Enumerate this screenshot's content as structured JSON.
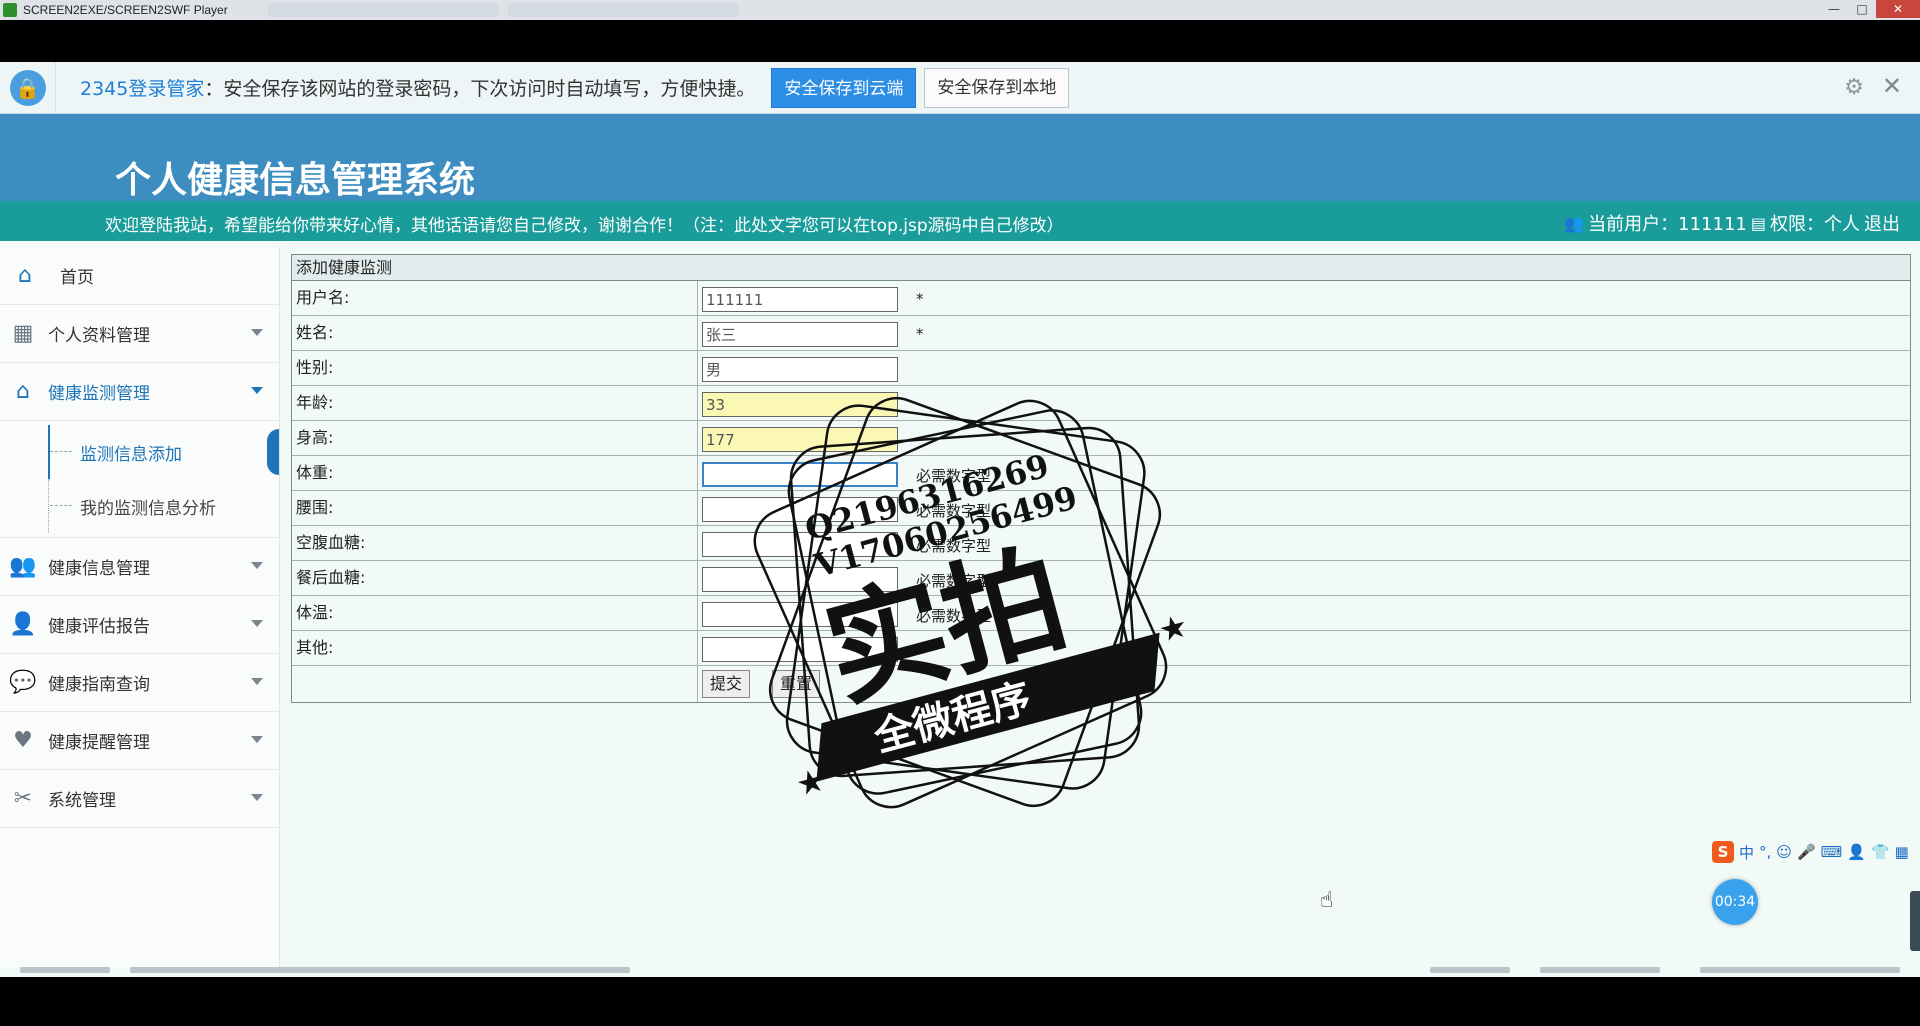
{
  "player": {
    "title": "SCREEN2EXE/SCREEN2SWF Player",
    "controls": [
      "—",
      "□",
      "✕"
    ]
  },
  "password_bar": {
    "brand": "2345登录管家",
    "message": "：安全保存该网站的登录密码，下次访问时自动填写，方便快捷。",
    "save_cloud": "安全保存到云端",
    "save_local": "安全保存到本地"
  },
  "app": {
    "title": "个人健康信息管理系统",
    "welcome": "欢迎登陆我站，希望能给你带来好心情，其他话语请您自己修改，谢谢合作！（注：此处文字您可以在top.jsp源码中自己修改）",
    "current_user_label": "当前用户：111111",
    "permission_label": "权限：个人",
    "logout": "退出"
  },
  "sidebar": {
    "home": "首页",
    "items": [
      {
        "label": "个人资料管理",
        "icon": "grid-icon"
      },
      {
        "label": "健康监测管理",
        "icon": "home-icon"
      },
      {
        "label": "健康信息管理",
        "icon": "users-icon"
      },
      {
        "label": "健康评估报告",
        "icon": "user-icon"
      },
      {
        "label": "健康指南查询",
        "icon": "chat-icon"
      },
      {
        "label": "健康提醒管理",
        "icon": "heart-icon"
      },
      {
        "label": "系统管理",
        "icon": "tools-icon"
      }
    ],
    "sub_items": [
      "监测信息添加",
      "我的监测信息分析"
    ]
  },
  "form": {
    "heading": "添加健康监测",
    "fields": [
      {
        "label": "用户名:",
        "value": "111111",
        "hint": "*"
      },
      {
        "label": "姓名:",
        "value": "张三",
        "hint": "*"
      },
      {
        "label": "性别:",
        "value": "男",
        "hint": ""
      },
      {
        "label": "年龄:",
        "value": "33",
        "hint": ""
      },
      {
        "label": "身高:",
        "value": "177",
        "hint": ""
      },
      {
        "label": "体重:",
        "value": "",
        "hint": "必需数字型"
      },
      {
        "label": "腰围:",
        "value": "",
        "hint": "必需数字型"
      },
      {
        "label": "空腹血糖:",
        "value": "",
        "hint": "必需数字型"
      },
      {
        "label": "餐后血糖:",
        "value": "",
        "hint": "必需数字型"
      },
      {
        "label": "体温:",
        "value": "",
        "hint": "必需数字型"
      },
      {
        "label": "其他:",
        "value": "",
        "hint": ""
      }
    ],
    "submit": "提交",
    "reset": "重置"
  },
  "watermark": {
    "qq": "Q2196316269",
    "vx": "V17060256499",
    "big": "实拍",
    "ribbon": "全微程序"
  },
  "ime": {
    "mode": "中",
    "punct": "°,"
  },
  "timer": "00:34"
}
